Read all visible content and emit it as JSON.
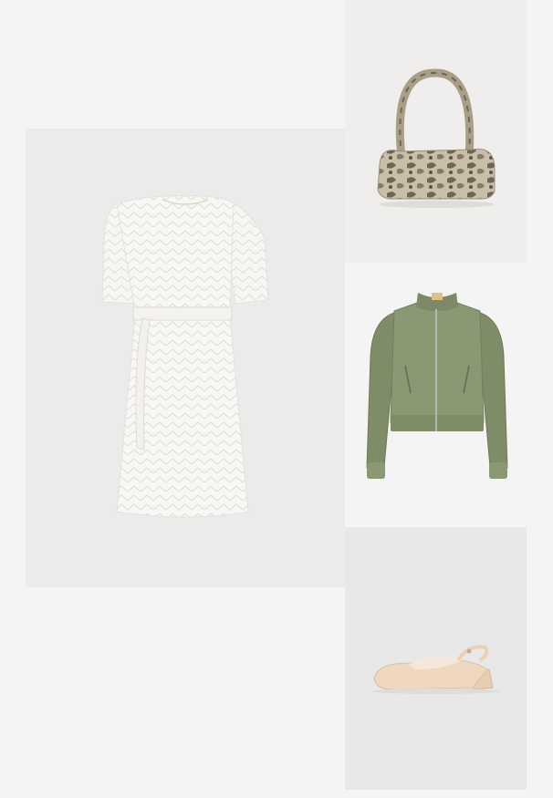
{
  "outfit": {
    "items": [
      {
        "key": "dress",
        "icon": "white-eyelet-dress-image",
        "color": "#f7f6f2",
        "background": "#ebebeb"
      },
      {
        "key": "bag",
        "icon": "snakeskin-shoulder-bag-image",
        "color": "#b7ab92",
        "background": "#efeeed"
      },
      {
        "key": "jacket",
        "icon": "olive-bomber-jacket-image",
        "color": "#8a9873",
        "background": "#f4f4f4"
      },
      {
        "key": "shoe",
        "icon": "nude-slingback-pump-image",
        "color": "#f0d8c0",
        "background": "#e8e8e8"
      }
    ]
  }
}
